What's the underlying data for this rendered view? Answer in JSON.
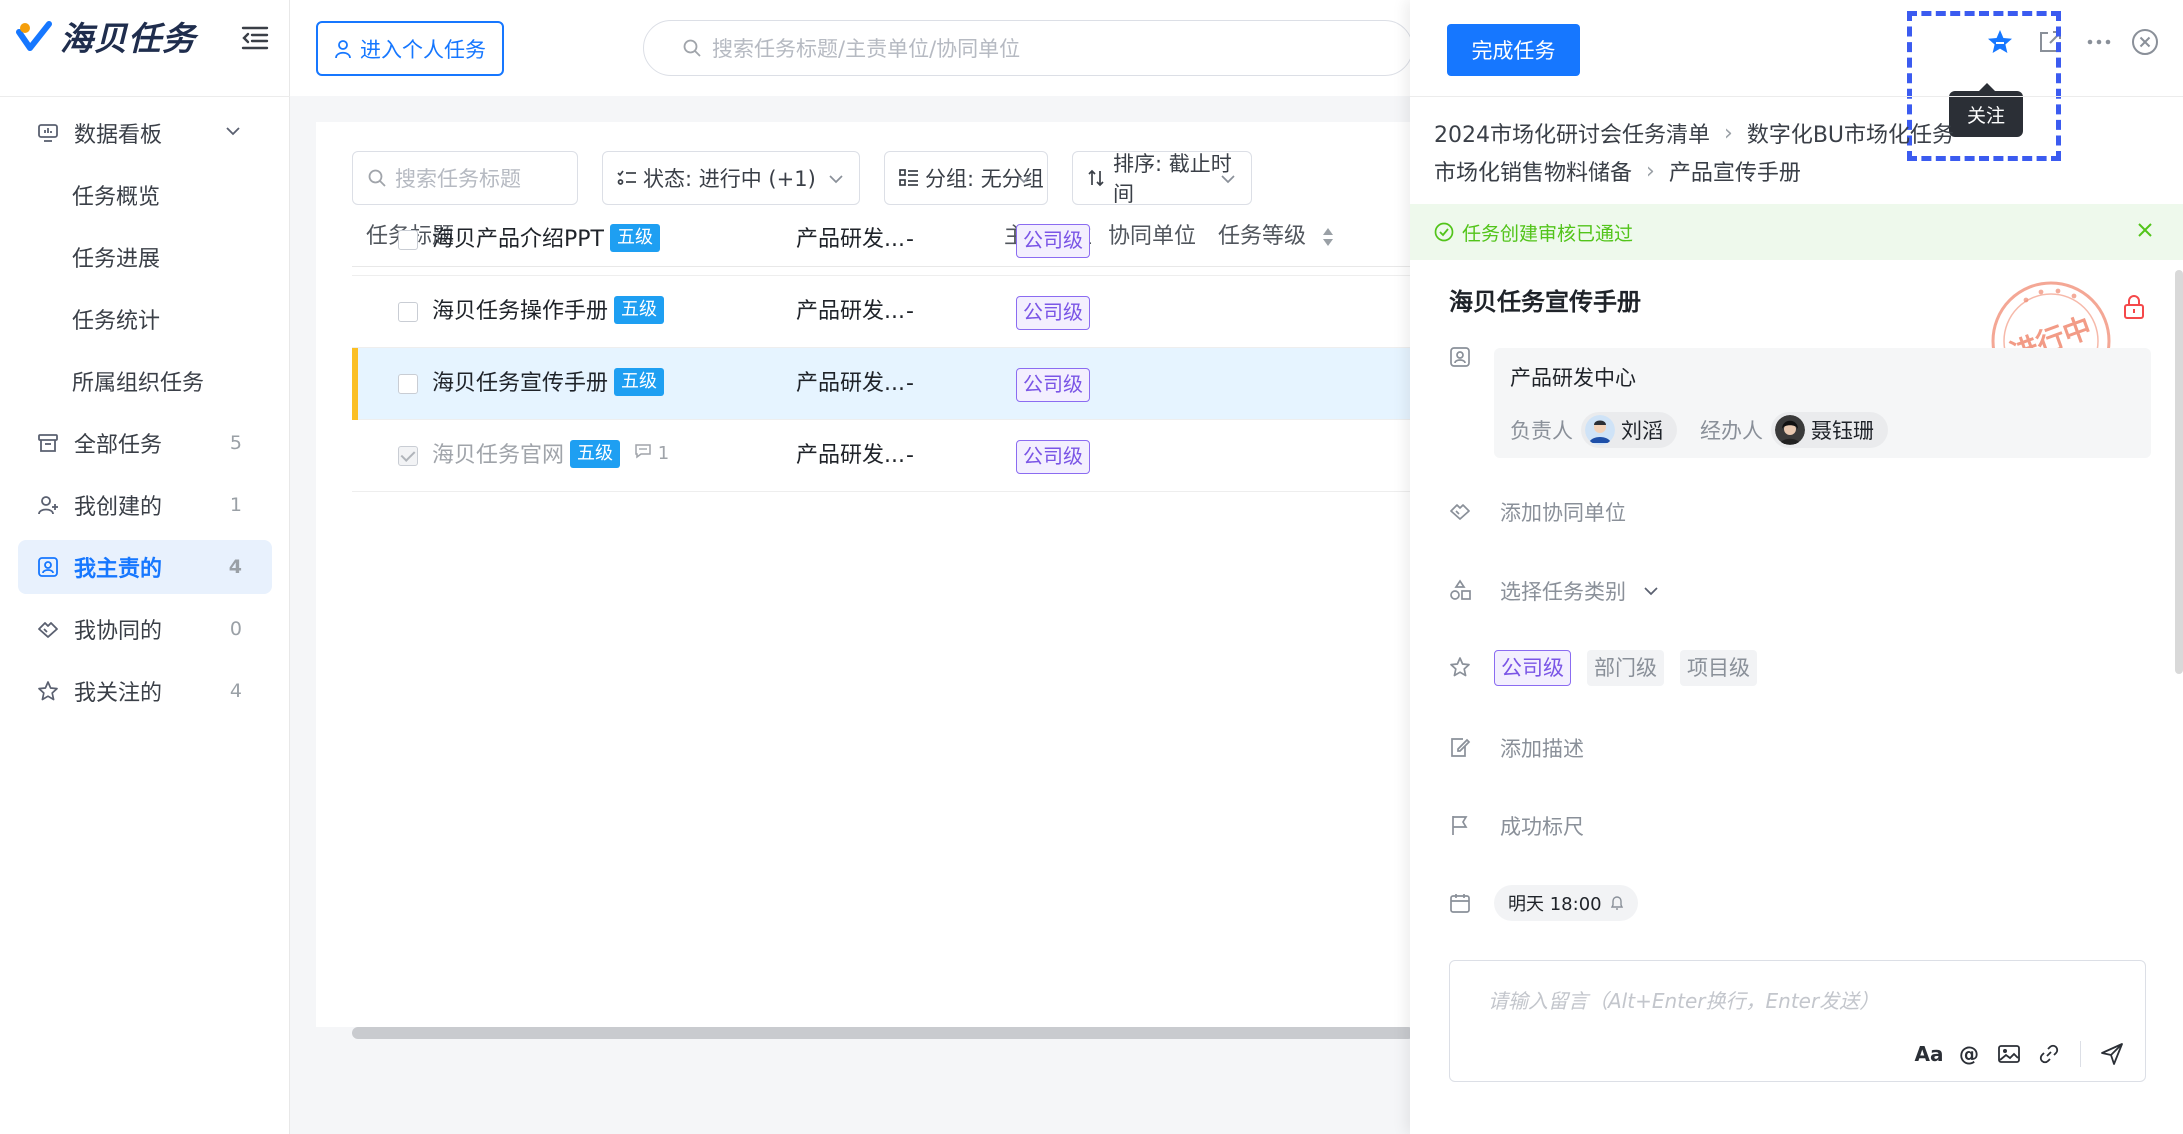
{
  "app": {
    "name": "海贝任务"
  },
  "sidebar": {
    "items": [
      {
        "label": "数据看板",
        "count": ""
      },
      {
        "label": "任务概览",
        "count": ""
      },
      {
        "label": "任务进展",
        "count": ""
      },
      {
        "label": "任务统计",
        "count": ""
      },
      {
        "label": "所属组织任务",
        "count": ""
      },
      {
        "label": "全部任务",
        "count": "5"
      },
      {
        "label": "我创建的",
        "count": "1"
      },
      {
        "label": "我主责的",
        "count": "4"
      },
      {
        "label": "我协同的",
        "count": "0"
      },
      {
        "label": "我关注的",
        "count": "4"
      }
    ]
  },
  "topbar": {
    "personal_button": "进入个人任务",
    "search_placeholder": "搜索任务标题/主责单位/协同单位"
  },
  "filters": {
    "search_placeholder": "搜索任务标题",
    "status": "状态: 进行中 (+1)",
    "group": "分组: 无分组",
    "sort": "排序: 截止时间"
  },
  "table": {
    "columns": [
      "任务标题",
      "主责单位",
      "协同单位",
      "任务等级"
    ],
    "rows": [
      {
        "title": "海贝产品介绍PPT",
        "badge": "五级",
        "unit": "产品研发...",
        "co": "-",
        "level": "公司级",
        "comments": ""
      },
      {
        "title": "海贝任务操作手册",
        "badge": "五级",
        "unit": "产品研发...",
        "co": "-",
        "level": "公司级",
        "comments": ""
      },
      {
        "title": "海贝任务宣传手册",
        "badge": "五级",
        "unit": "产品研发...",
        "co": "-",
        "level": "公司级",
        "comments": ""
      },
      {
        "title": "海贝任务官网",
        "badge": "五级",
        "unit": "产品研发...",
        "co": "-",
        "level": "公司级",
        "comments": "1"
      }
    ]
  },
  "panel": {
    "complete_button": "完成任务",
    "tooltip": "关注",
    "breadcrumb": [
      "2024市场化研讨会任务清单",
      "数字化BU市场化任务",
      "市场化销售物料储备",
      "产品宣传手册"
    ],
    "approve_msg": "任务创建审核已通过",
    "task_title": "海贝任务宣传手册",
    "stamp_text": "进行中",
    "owner_unit": "产品研发中心",
    "owner_label": "负责人",
    "owner_name": "刘滔",
    "handler_label": "经办人",
    "handler_name": "聂钰珊",
    "add_cooperator": "添加协同单位",
    "choose_category": "选择任务类别",
    "levels": [
      "公司级",
      "部门级",
      "项目级"
    ],
    "add_description": "添加描述",
    "success_criteria": "成功标尺",
    "due": "明天 18:00",
    "comment_placeholder": "请输入留言（Alt+Enter换行，Enter发送）",
    "font_tool": "Aa",
    "mention_tool": "@"
  },
  "colors": {
    "primary": "#1677ff",
    "level_tag": "#7a55e6",
    "badge": "#1e9ff2",
    "approve": "#52c41a",
    "highlight": "#3b5bf0"
  }
}
